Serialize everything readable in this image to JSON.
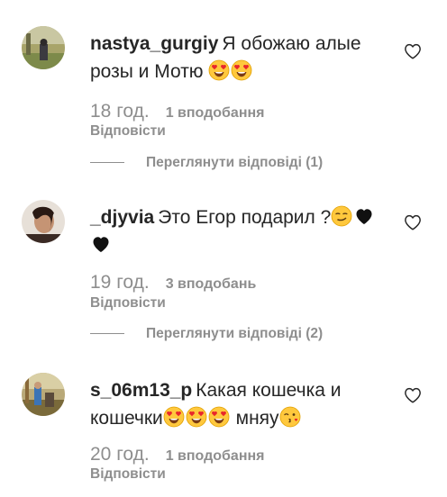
{
  "comments": [
    {
      "username": "nastya_gurgiy",
      "text_a": "Я обожаю алые",
      "text_b": "розы и Мотю",
      "time": "18 год.",
      "likes": "1 вподобання",
      "reply": "Відповісти",
      "view_replies": "Переглянути відповіді (1)"
    },
    {
      "username": "_djyvia",
      "text_a": "Это Егор подарил ?",
      "time": "19 год.",
      "likes": "3 вподобань",
      "reply": "Відповісти",
      "view_replies": "Переглянути відповіді (2)"
    },
    {
      "username": "s_06m13_p",
      "text_a": "Какая кошечка и",
      "text_b": "кошечки",
      "text_c": "мняу",
      "time": "20 год.",
      "likes": "1 вподобання",
      "reply": "Відповісти"
    }
  ],
  "icons": {
    "like": "heart-outline-icon",
    "heart_eyes": "heart-eyes-emoji",
    "smirk": "smirking-face-emoji",
    "black_heart": "black-heart-emoji",
    "kiss": "face-blowing-kiss-emoji"
  },
  "colors": {
    "text": "#262626",
    "muted": "#8e8e8e"
  }
}
